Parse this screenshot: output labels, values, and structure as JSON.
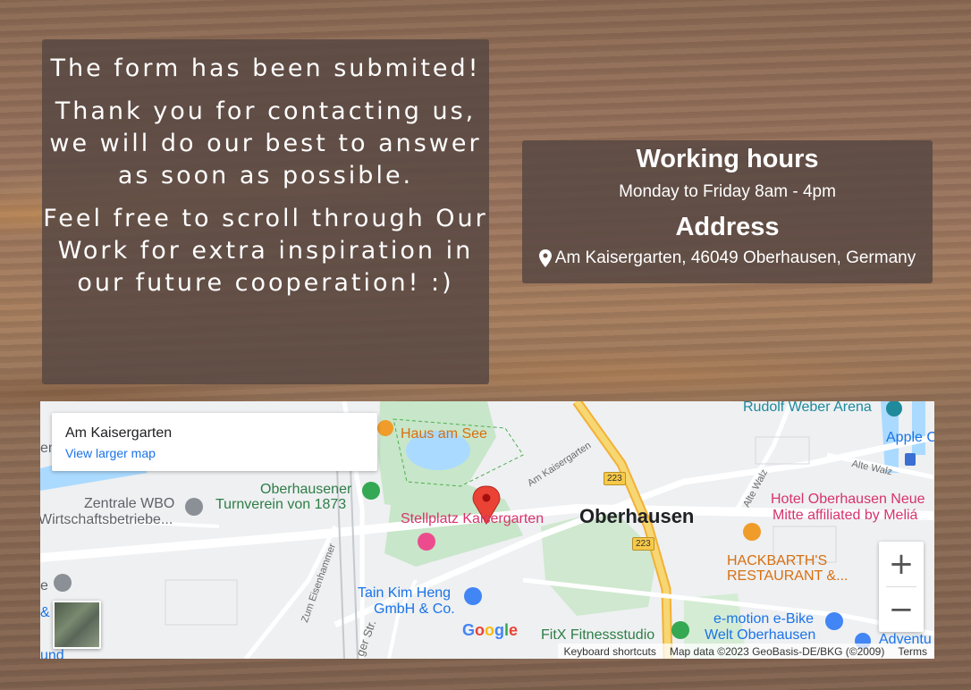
{
  "message": {
    "line1": "The form has been submited!",
    "line2": "Thank you for contacting us, we will do our best to answer as soon as possible.",
    "line3": "Feel free to scroll through Our Work for extra inspiration in our future cooperation! :)"
  },
  "info": {
    "hours_title": "Working hours",
    "hours_text": "Monday to Friday 8am - 4pm",
    "address_title": "Address",
    "address_text": "Am Kaisergarten, 46049 Oberhausen, Germany",
    "pin_icon": "map-marker-icon"
  },
  "map": {
    "place_title": "Am Kaisergarten",
    "larger_map_link": "View larger map",
    "city": "Oberhausen",
    "zoom_in": "+",
    "zoom_out": "−",
    "keyboard_shortcuts": "Keyboard shortcuts",
    "map_data": "Map data ©2023 GeoBasis-DE/BKG (©2009)",
    "terms": "Terms",
    "google": "Google",
    "labels": {
      "rudolf": "Rudolf Weber Arena",
      "apple": "Apple C",
      "haus": "Haus am See",
      "ober_turn1": "Oberhausener",
      "ober_turn2": "Turnverein von 1873",
      "zentrale1": "Zentrale WBO",
      "zentrale2": "Wirtschaftsbetriebe...",
      "stellplatz": "Stellplatz Kaisergarten",
      "hotel1": "Hotel Oberhausen Neue",
      "hotel2": "Mitte affiliated by Meliá",
      "hackbarth1": "HACKBARTH'S",
      "hackbarth2": "RESTAURANT &...",
      "tain1": "Tain Kim Heng",
      "tain2": "GmbH & Co.",
      "fitx": "FitX Fitnessstudio",
      "ebike1": "e-motion e-Bike",
      "ebike2": "Welt Oberhausen",
      "advent": "Adventu",
      "am_kaisergarten_st": "Am Kaisergarten",
      "alte_walz": "Alte Walz",
      "alte_walz2": "Alte Walz",
      "zum_eisenhammer": "Zum Eisenhammer",
      "ger_str": "ger Str.",
      "road223a": "223",
      "road223b": "223",
      "left_e": "e",
      "left_en": "en",
      "left_amp": "&",
      "left_und": "und"
    }
  },
  "colors": {
    "panel": "#584842",
    "map_bg": "#eef0f2",
    "park": "#c8e6c9",
    "water": "#aadaff",
    "highway": "#f7c948",
    "marker": "#ea4335"
  }
}
